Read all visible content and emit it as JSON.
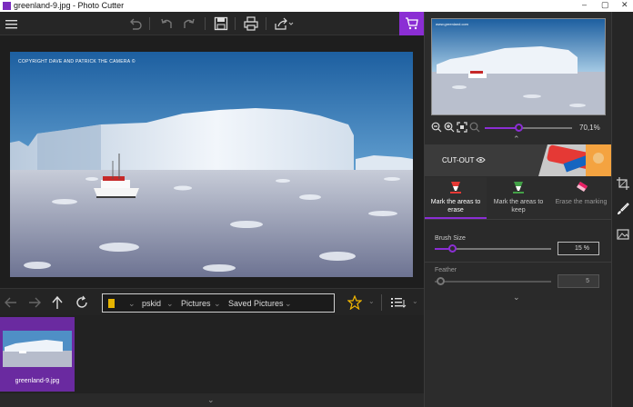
{
  "window": {
    "title": "greenland-9.jpg - Photo Cutter",
    "controls": {
      "minimize": "–",
      "maximize": "▢",
      "close": "✕"
    }
  },
  "toolbar": {
    "icons": [
      "hamburger-menu-icon",
      "undo-history-icon",
      "undo-icon",
      "redo-icon",
      "save-icon",
      "print-icon",
      "share-icon",
      "cart-icon"
    ],
    "accent": "#8b2ed4"
  },
  "image": {
    "copyright": "COPYRIGHT DAVE AND PATRICK THE CAMERA ©",
    "preview_caption": "www.greenland.com"
  },
  "navigator": {
    "path": [
      "pskid",
      "Pictures",
      "Saved Pictures"
    ],
    "icons": [
      "back-arrow-icon",
      "forward-arrow-icon",
      "up-arrow-icon",
      "refresh-icon",
      "folder-icon",
      "star-icon",
      "sort-icon"
    ]
  },
  "filmstrip": {
    "items": [
      {
        "filename": "greenland-9.jpg",
        "selected": true
      }
    ]
  },
  "panel": {
    "zoom": {
      "label": "70,1%",
      "value": 0.701
    },
    "cutout_label": "CUT-OUT",
    "modes": [
      {
        "label": "Mark the areas to erase",
        "active": true,
        "color": "#e53935"
      },
      {
        "label": "Mark the areas to keep",
        "active": false,
        "color": "#43a047"
      },
      {
        "label": "Erase the marking",
        "active": false,
        "color": "#e91e63"
      }
    ],
    "brush": {
      "label": "Brush Size",
      "value": "15 %",
      "fraction": 0.15
    },
    "feather": {
      "label": "Feather",
      "value": "5",
      "fraction": 0.05
    }
  },
  "rail": {
    "icons": [
      "crop-icon",
      "brush-icon",
      "image-icon"
    ]
  }
}
